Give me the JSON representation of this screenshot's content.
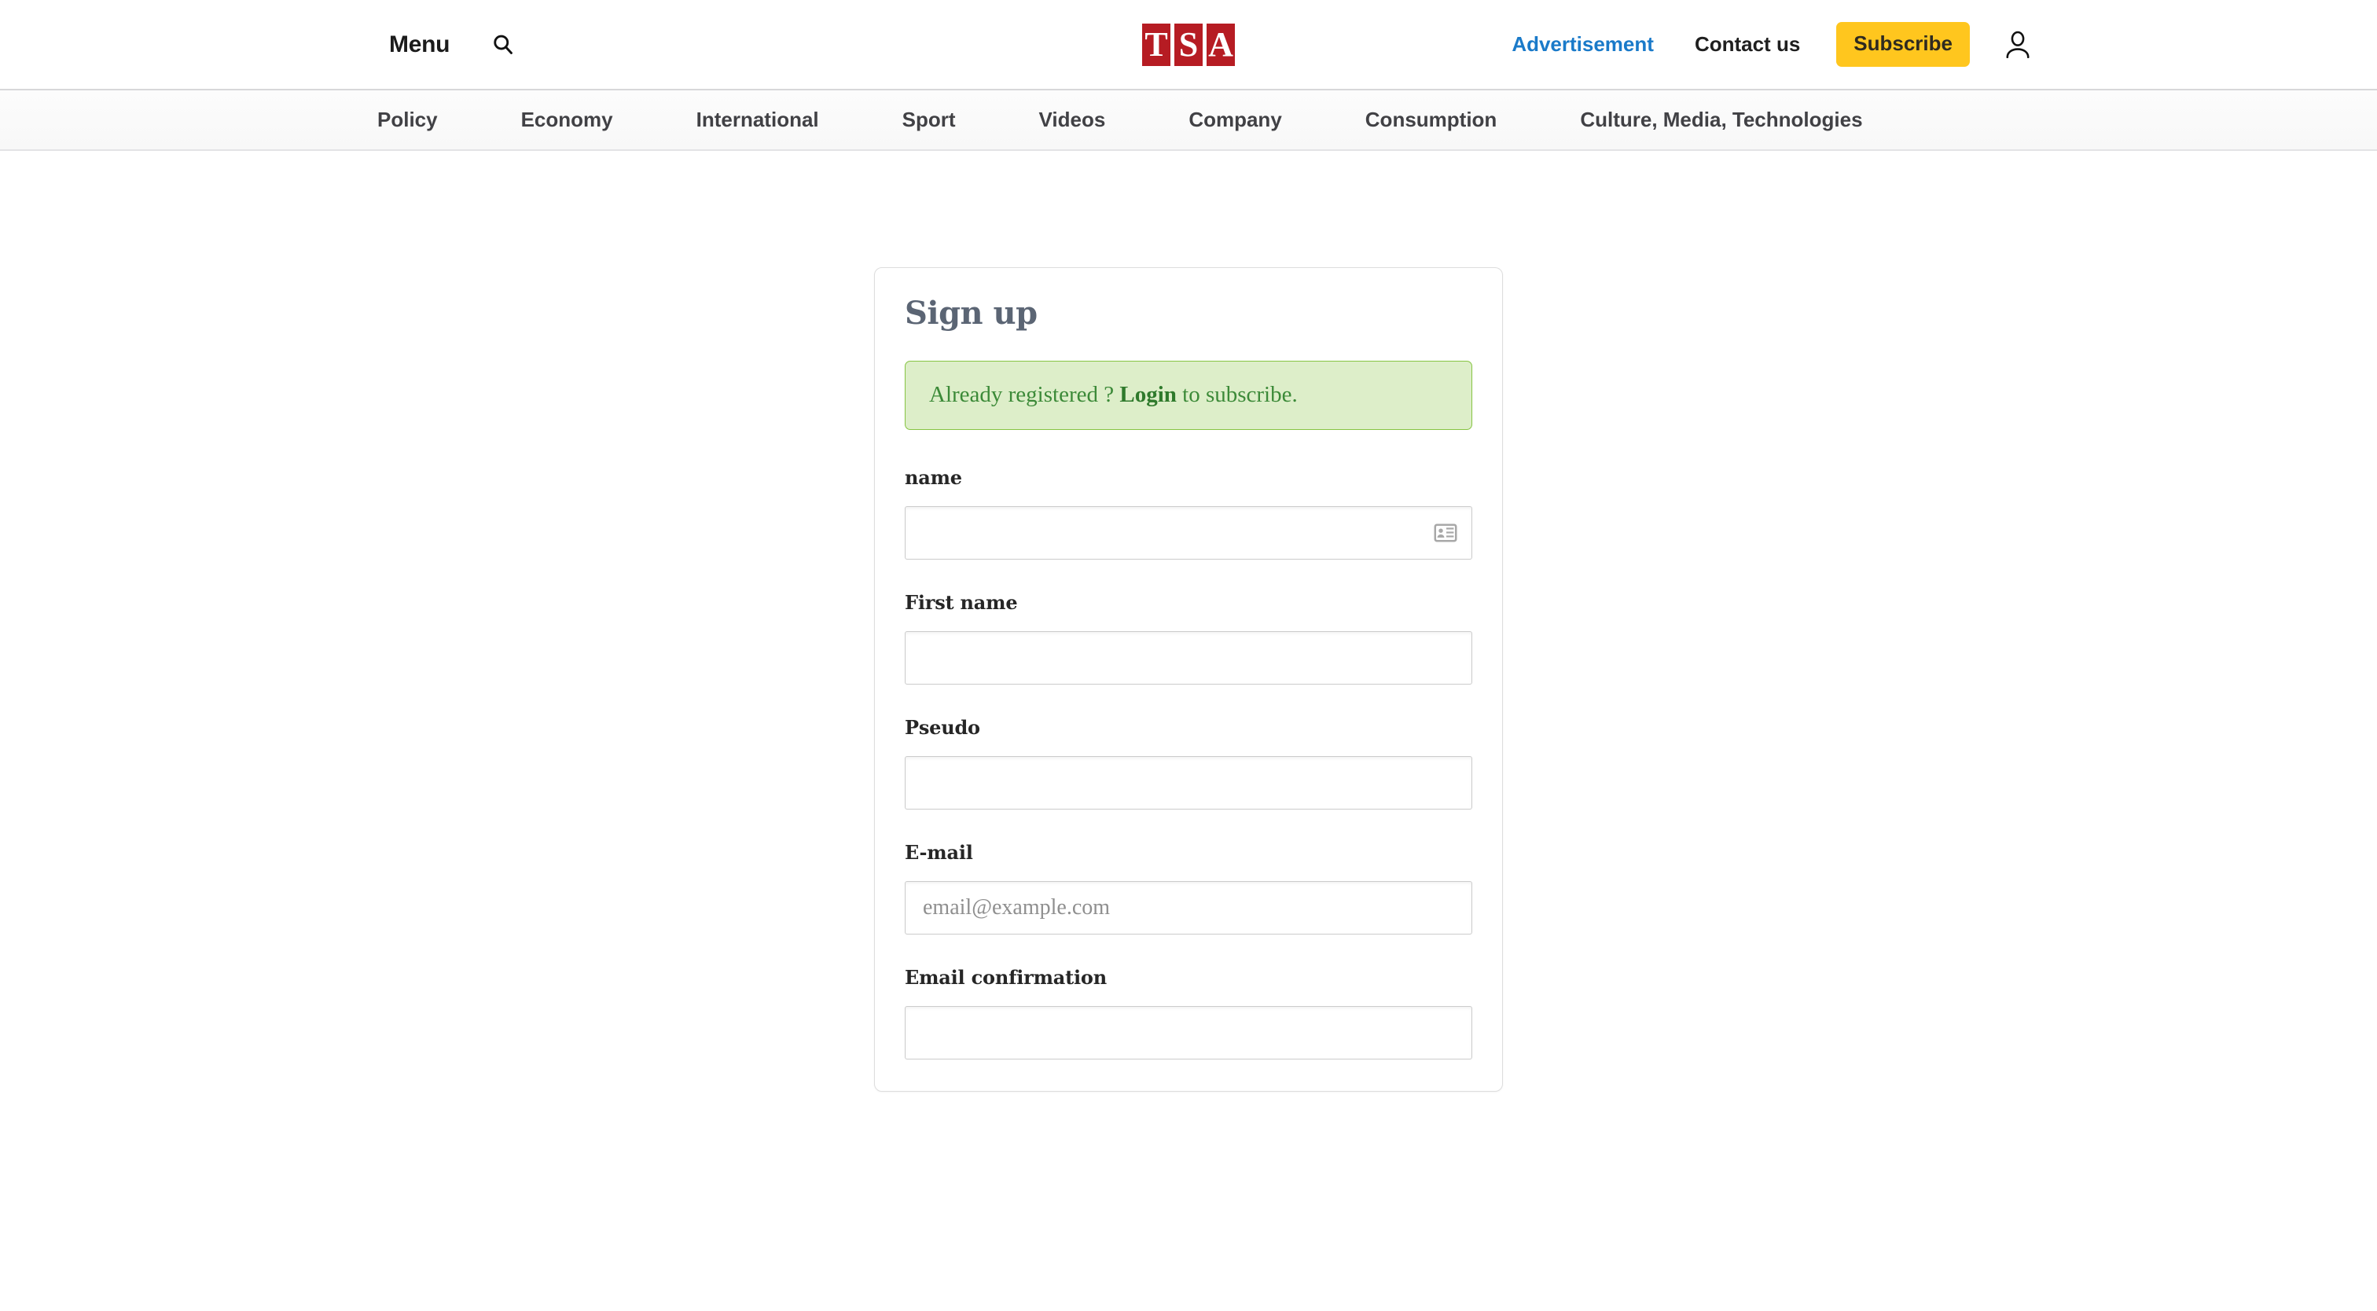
{
  "header": {
    "menu_label": "Menu",
    "search_icon": "search-icon",
    "logo": {
      "tiles": [
        "T",
        "S",
        "A"
      ],
      "color": "#b61c23"
    },
    "links": [
      {
        "label": "Advertisement",
        "color": "#1a7ac9"
      },
      {
        "label": "Contact us",
        "color": "#1f1f1f"
      }
    ],
    "subscribe_label": "Subscribe",
    "subscribe_color": "#ffc61e",
    "account_icon": "user-account-icon"
  },
  "category_nav": {
    "items": [
      {
        "label": "Policy"
      },
      {
        "label": "Economy"
      },
      {
        "label": "International"
      },
      {
        "label": "Sport"
      },
      {
        "label": "Videos"
      },
      {
        "label": "Company"
      },
      {
        "label": "Consumption"
      },
      {
        "label": "Culture, Media, Technologies"
      }
    ]
  },
  "signup": {
    "title": "Sign up",
    "alert": {
      "prefix": "Already registered ? ",
      "link_label": "Login",
      "suffix": " to subscribe.",
      "bg_color": "#ddeec9",
      "border_color": "#86c442",
      "text_color": "#3c8a38"
    },
    "fields": [
      {
        "label": "name",
        "value": "",
        "placeholder": "",
        "has_autofill_icon": true
      },
      {
        "label": "First name",
        "value": "",
        "placeholder": "",
        "has_autofill_icon": false
      },
      {
        "label": "Pseudo",
        "value": "",
        "placeholder": "",
        "has_autofill_icon": false
      },
      {
        "label": "E-mail",
        "value": "",
        "placeholder": "email@example.com",
        "has_autofill_icon": false
      },
      {
        "label": "Email confirmation",
        "value": "",
        "placeholder": "",
        "has_autofill_icon": false
      }
    ]
  }
}
